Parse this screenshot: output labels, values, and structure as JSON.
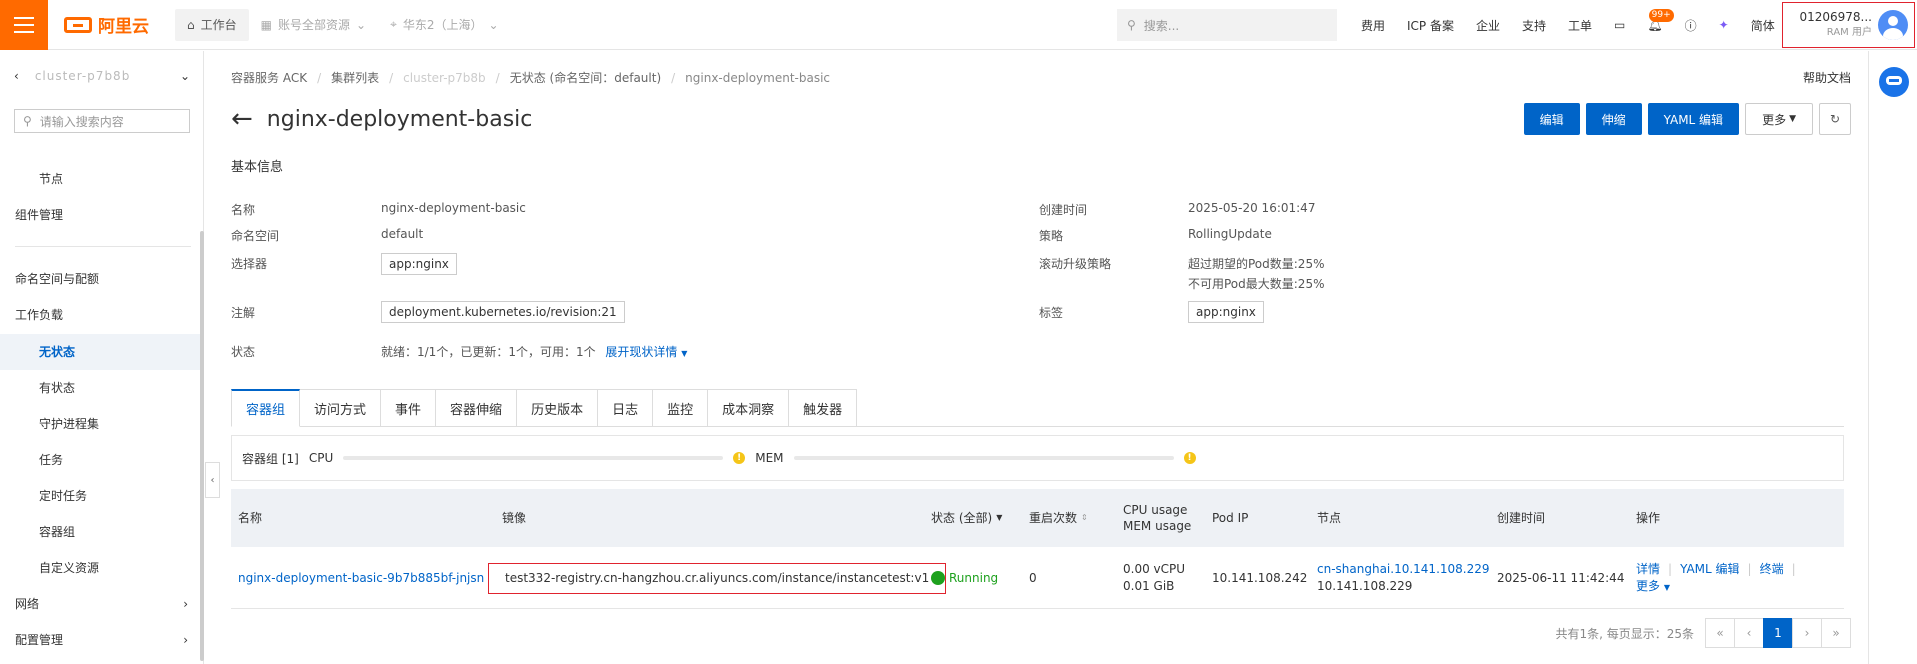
{
  "topbar": {
    "logo_text": "阿里云",
    "workbench": "工作台",
    "account_resources": "账号全部资源",
    "region": "华东2（上海）",
    "search_placeholder": "搜索...",
    "links": [
      "费用",
      "ICP 备案",
      "企业",
      "支持",
      "工单"
    ],
    "notification_badge": "99+",
    "language": "简体",
    "user_id": "01206978...",
    "user_role": "RAM 用户"
  },
  "sidebar": {
    "cluster_name": "cluster-p7b8b",
    "search_placeholder": "请输入搜索内容",
    "items": [
      {
        "label": "节点",
        "level": 2
      },
      {
        "label": "组件管理",
        "level": 1
      },
      {
        "label": "命名空间与配额",
        "level": 1
      },
      {
        "label": "工作负载",
        "level": 1
      },
      {
        "label": "无状态",
        "level": 2,
        "active": true
      },
      {
        "label": "有状态",
        "level": 2
      },
      {
        "label": "守护进程集",
        "level": 2
      },
      {
        "label": "任务",
        "level": 2
      },
      {
        "label": "定时任务",
        "level": 2
      },
      {
        "label": "容器组",
        "level": 2
      },
      {
        "label": "自定义资源",
        "level": 2
      },
      {
        "label": "网络",
        "level": 1,
        "expandable": true
      },
      {
        "label": "配置管理",
        "level": 1,
        "expandable": true
      }
    ]
  },
  "breadcrumb": [
    "容器服务 ACK",
    "集群列表",
    "cluster-p7b8b",
    "无状态 (命名空间：default)",
    "nginx-deployment-basic"
  ],
  "help_doc": "帮助文档",
  "page_title": "nginx-deployment-basic",
  "actions": {
    "edit": "编辑",
    "scale": "伸缩",
    "yaml_edit": "YAML 编辑",
    "more": "更多"
  },
  "basic_info": {
    "section_title": "基本信息",
    "name_label": "名称",
    "name": "nginx-deployment-basic",
    "namespace_label": "命名空间",
    "namespace": "default",
    "selector_label": "选择器",
    "selector": "app:nginx",
    "annotation_label": "注解",
    "annotation": "deployment.kubernetes.io/revision:21",
    "status_label": "状态",
    "status": "就绪：1/1个，已更新：1个，可用：1个",
    "expand_status": "展开现状详情",
    "created_label": "创建时间",
    "created": "2025-05-20 16:01:47",
    "strategy_label": "策略",
    "strategy": "RollingUpdate",
    "rolling_label": "滚动升级策略",
    "rolling_surge": "超过期望的Pod数量:25%",
    "rolling_unavailable": "不可用Pod最大数量:25%",
    "labels_label": "标签",
    "labels": "app:nginx"
  },
  "tabs": [
    "容器组",
    "访问方式",
    "事件",
    "容器伸缩",
    "历史版本",
    "日志",
    "监控",
    "成本洞察",
    "触发器"
  ],
  "usage": {
    "group_label": "容器组 [1]",
    "cpu_label": "CPU",
    "mem_label": "MEM"
  },
  "table": {
    "headers": {
      "name": "名称",
      "image": "镜像",
      "status": "状态 (全部)",
      "restarts": "重启次数",
      "cpu_usage": "CPU usage",
      "mem_usage": "MEM usage",
      "pod_ip": "Pod IP",
      "node": "节点",
      "created": "创建时间",
      "ops": "操作"
    },
    "rows": [
      {
        "name": "nginx-deployment-basic-9b7b885bf-jnjsn",
        "image": "test332-registry.cn-hangzhou.cr.aliyuncs.com/instance/instancetest:v1",
        "status": "Running",
        "restarts": "0",
        "cpu": "0.00 vCPU",
        "mem": "0.01 GiB",
        "pod_ip": "10.141.108.242",
        "node_link": "cn-shanghai.10.141.108.229",
        "node_ip": "10.141.108.229",
        "created": "2025-06-11 11:42:44",
        "ops": [
          "详情",
          "YAML 编辑",
          "终端"
        ],
        "more": "更多"
      }
    ]
  },
  "pagination": {
    "summary": "共有1条, 每页显示：25条",
    "current_page": "1"
  },
  "colors": {
    "brand": "#ff6a00",
    "primary": "#0064c8",
    "running": "#1ea11e",
    "highlight_border": "#e0232e"
  }
}
